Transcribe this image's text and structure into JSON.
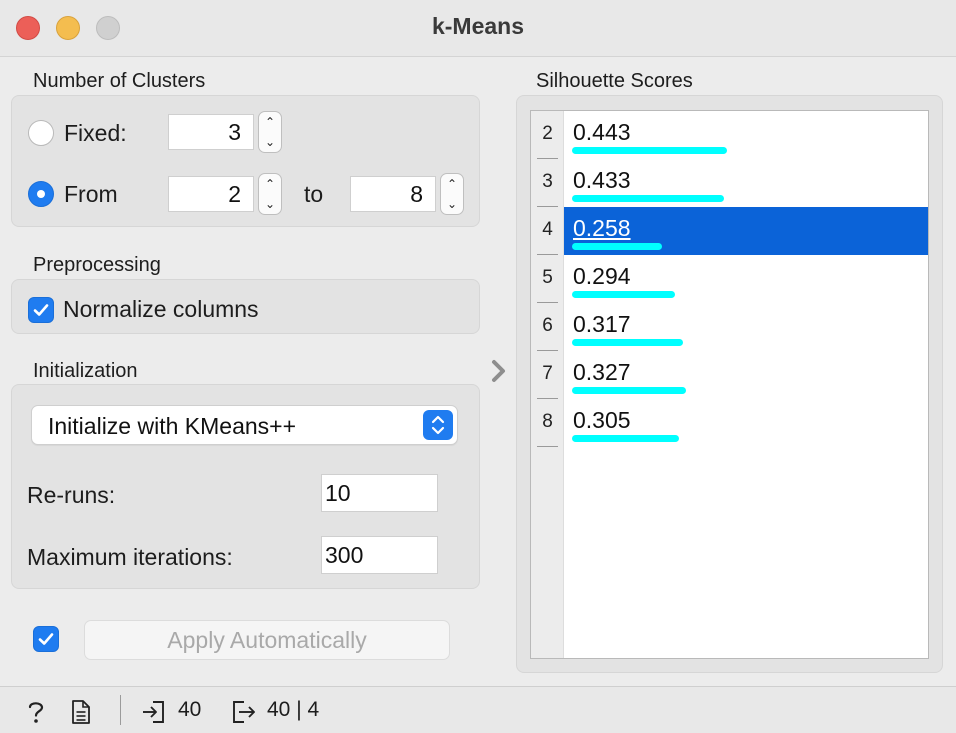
{
  "window": {
    "title": "k-Means"
  },
  "clusters": {
    "section_label": "Number of Clusters",
    "fixed_label": "Fixed:",
    "fixed_value": "3",
    "from_label": "From",
    "from_value": "2",
    "to_label": "to",
    "to_value": "8",
    "selected_mode": "from"
  },
  "preprocessing": {
    "section_label": "Preprocessing",
    "normalize_label": "Normalize columns",
    "normalize_checked": true
  },
  "initialization": {
    "section_label": "Initialization",
    "method": "Initialize with KMeans++",
    "reruns_label": "Re-runs:",
    "reruns_value": "10",
    "max_iter_label": "Maximum iterations:",
    "max_iter_value": "300"
  },
  "apply": {
    "label": "Apply Automatically",
    "auto_checked": true
  },
  "silhouette": {
    "section_label": "Silhouette Scores",
    "rows": [
      {
        "k": "2",
        "score": "0.443",
        "bar_fraction": 0.443,
        "selected": false
      },
      {
        "k": "3",
        "score": "0.433",
        "bar_fraction": 0.433,
        "selected": false
      },
      {
        "k": "4",
        "score": "0.258",
        "bar_fraction": 0.258,
        "selected": true
      },
      {
        "k": "5",
        "score": "0.294",
        "bar_fraction": 0.294,
        "selected": false
      },
      {
        "k": "6",
        "score": "0.317",
        "bar_fraction": 0.317,
        "selected": false
      },
      {
        "k": "7",
        "score": "0.327",
        "bar_fraction": 0.327,
        "selected": false
      },
      {
        "k": "8",
        "score": "0.305",
        "bar_fraction": 0.305,
        "selected": false
      }
    ]
  },
  "status": {
    "input_count": "40",
    "output_count": "40 | 4"
  },
  "colors": {
    "accent": "#1f7cf0",
    "selection": "#0b63d8",
    "bar": "#00ffff"
  },
  "icons": [
    "help-icon",
    "report-icon",
    "input-icon",
    "output-icon",
    "chevron-right-icon"
  ]
}
